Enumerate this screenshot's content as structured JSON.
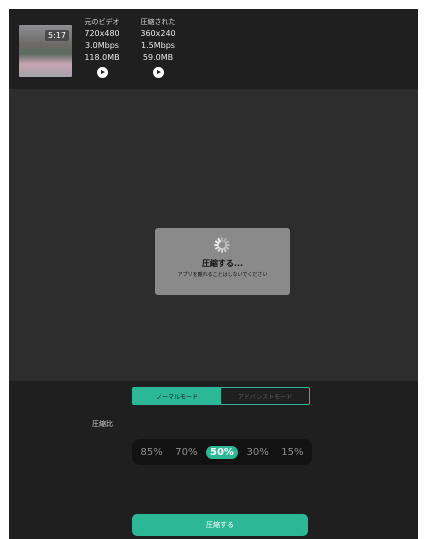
{
  "video": {
    "duration": "5:17",
    "original": {
      "label": "元のビデオ",
      "resolution": "720x480",
      "bitrate": "3.0Mbps",
      "size": "118.0MB"
    },
    "compressed": {
      "label": "圧縮された",
      "resolution": "360x240",
      "bitrate": "1.5Mbps",
      "size": "59.0MB"
    }
  },
  "dialog": {
    "title": "圧縮する...",
    "message": "アプリを離れることはしないでください"
  },
  "modes": {
    "normal": "ノーマルモード",
    "advanced": "アドバンストモード",
    "active": "normal"
  },
  "ratio": {
    "label": "圧縮比",
    "options": [
      "85%",
      "70%",
      "50%",
      "30%",
      "15%"
    ],
    "selected": "50%"
  },
  "action": {
    "compress_label": "圧縮する"
  },
  "colors": {
    "accent": "#2cb896",
    "panel": "#1f1f1f",
    "background": "#2d2d2d"
  }
}
